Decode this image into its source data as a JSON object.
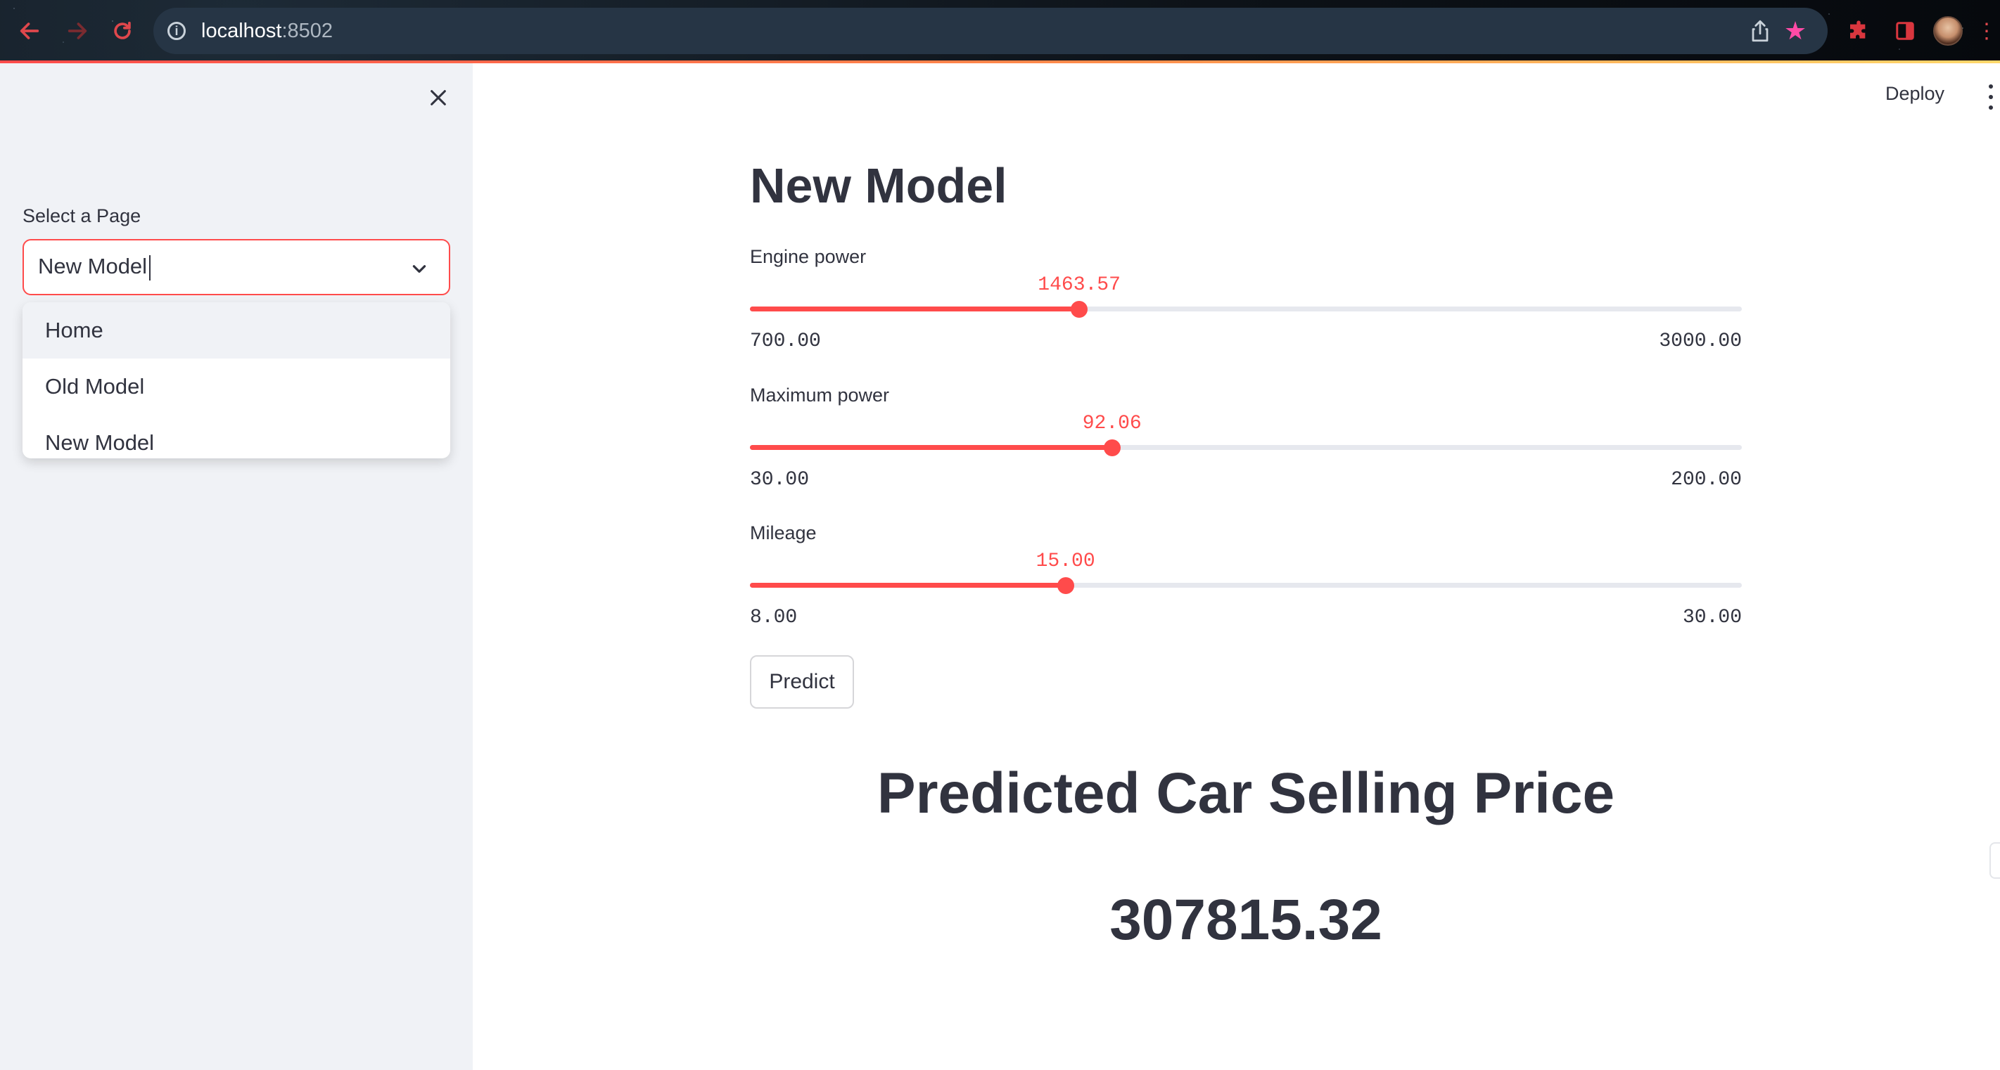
{
  "browser": {
    "url_host": "localhost",
    "url_port": ":8502"
  },
  "sidebar": {
    "select_label": "Select a Page",
    "selected_value": "New Model",
    "options": [
      "Home",
      "Old Model",
      "New Model"
    ],
    "highlighted_option": "Home"
  },
  "toolbar": {
    "deploy_label": "Deploy"
  },
  "main": {
    "title": "New Model",
    "sliders": [
      {
        "label": "Engine power",
        "value": "1463.57",
        "min": "700.00",
        "max": "3000.00",
        "value_num": 1463.57,
        "min_num": 700,
        "max_num": 3000
      },
      {
        "label": "Maximum power",
        "value": "92.06",
        "min": "30.00",
        "max": "200.00",
        "value_num": 92.06,
        "min_num": 30,
        "max_num": 200
      },
      {
        "label": "Mileage",
        "value": "15.00",
        "min": "8.00",
        "max": "30.00",
        "value_num": 15,
        "min_num": 8,
        "max_num": 30
      }
    ],
    "predict_label": "Predict",
    "result_heading": "Predicted Car Selling Price",
    "result_value": "307815.32"
  },
  "colors": {
    "accent": "#ff4b4b",
    "text": "#31333f",
    "sidebar_bg": "#f0f2f6",
    "track": "#e6e8ee",
    "star": "#ff4ba6"
  },
  "icons": {
    "back": "arrow-left-icon",
    "forward": "arrow-right-icon",
    "reload": "reload-icon",
    "info": "info-icon",
    "share": "share-icon",
    "bookmark": "star-icon",
    "extensions": "puzzle-icon",
    "sidebar_toggle": "sidebar-icon",
    "close": "close-icon",
    "chevron": "chevron-down-icon",
    "more": "more-vertical-icon"
  }
}
